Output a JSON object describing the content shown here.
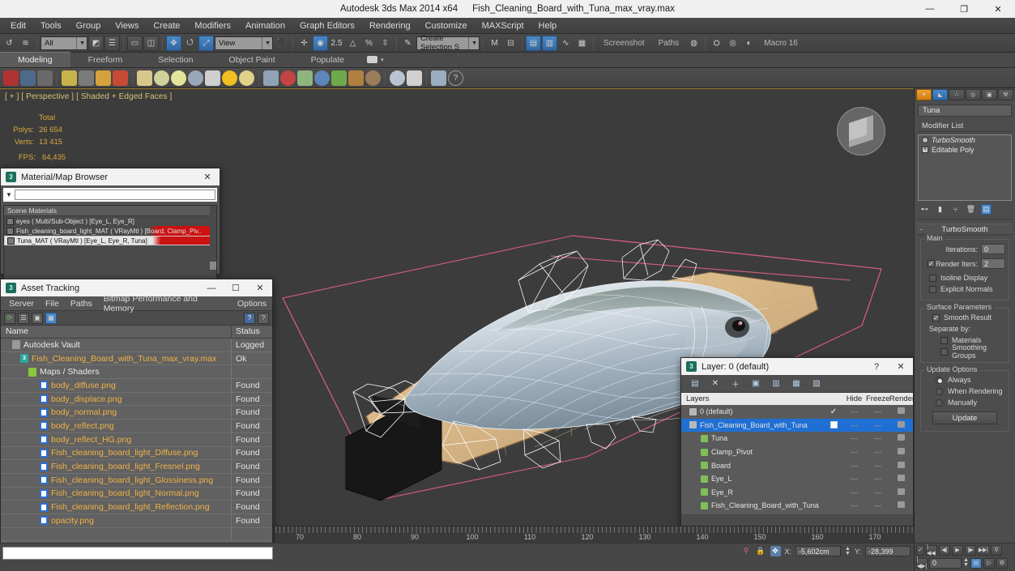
{
  "titlebar": {
    "app": "Autodesk 3ds Max  2014 x64",
    "file": "Fish_Cleaning_Board_with_Tuna_max_vray.max",
    "minimize": "—",
    "maximize": "❐",
    "close": "✕"
  },
  "menu": {
    "items": [
      "Edit",
      "Tools",
      "Group",
      "Views",
      "Create",
      "Modifiers",
      "Animation",
      "Graph Editors",
      "Rendering",
      "Customize",
      "MAXScript",
      "Help"
    ]
  },
  "main_toolbar": {
    "selection_filter": "All",
    "coord_system": "View",
    "named_selection_sets": "Create Selection S",
    "labels": {
      "screenshot": "Screenshot",
      "paths": "Paths",
      "macro": "Macro 16"
    },
    "icons": [
      "undo-icon",
      "redo-icon",
      "select-object-icon",
      "select-by-name-icon",
      "rectangular-select-icon",
      "window-crossing-icon",
      "select-and-move-icon",
      "select-and-rotate-icon",
      "select-and-scale-icon",
      "use-pivot-point-icon",
      "select-and-manipulate-icon",
      "snaps-toggle-icon",
      "angle-snap-icon",
      "percent-snap-icon",
      "spinner-snap-icon",
      "edit-named-selection-icon",
      "mirror-icon",
      "align-icon",
      "layer-manager-icon",
      "curve-editor-icon",
      "schematic-view-icon",
      "material-editor-icon",
      "render-setup-icon",
      "rendered-frame-icon",
      "render-production-icon"
    ]
  },
  "ribbon": {
    "tabs": [
      "Modeling",
      "Freeform",
      "Selection",
      "Object Paint",
      "Populate"
    ],
    "active_tab": "Modeling"
  },
  "viewport": {
    "label": "[ + ] [ Perspective ] [ Shaded + Edged Faces ]",
    "stats_header": "Total",
    "polys_label": "Polys:",
    "polys_value": "26 654",
    "verts_label": "Verts:",
    "verts_value": "13 415",
    "fps_label": "FPS:",
    "fps_value": "64,435"
  },
  "material_browser": {
    "title": "Material/Map Browser",
    "close": "✕",
    "search_placeholder": "",
    "group": "Scene Materials",
    "rows": [
      {
        "name": "eyes  ( Multi/Sub-Object )  [Eye_L, Eye_R]",
        "state": "normal"
      },
      {
        "name": "Fish_cleaning_board_light_MAT  ( VRayMtl )  [Board, Clamp_Piv..",
        "state": "red"
      },
      {
        "name": "Tuna_MAT  ( VRayMtl )  [Eye_L, Eye_R, Tuna]",
        "state": "selected"
      }
    ]
  },
  "asset_tracking": {
    "title": "Asset Tracking",
    "minimize": "—",
    "maximize": "☐",
    "close": "✕",
    "menu": [
      "Server",
      "File",
      "Paths",
      "Bitmap Performance and Memory",
      "Options"
    ],
    "columns": {
      "name": "Name",
      "status": "Status"
    },
    "rows": [
      {
        "name": "Autodesk Vault",
        "status": "Logged",
        "icon": "vault-icon",
        "indent": 1
      },
      {
        "name": "Fish_Cleaning_Board_with_Tuna_max_vray.max",
        "status": "Ok",
        "icon": "max-file-icon",
        "indent": 2,
        "highlight": true
      },
      {
        "name": "Maps / Shaders",
        "status": "",
        "icon": "folder-icon",
        "indent": 3
      },
      {
        "name": "body_diffuse.png",
        "status": "Found",
        "icon": "png-file-icon",
        "indent": 4,
        "highlight": true
      },
      {
        "name": "body_displace.png",
        "status": "Found",
        "icon": "png-file-icon",
        "indent": 4,
        "highlight": true
      },
      {
        "name": "body_normal.png",
        "status": "Found",
        "icon": "png-file-icon",
        "indent": 4,
        "highlight": true
      },
      {
        "name": "body_reflect.png",
        "status": "Found",
        "icon": "png-file-icon",
        "indent": 4,
        "highlight": true
      },
      {
        "name": "body_reflect_HG.png",
        "status": "Found",
        "icon": "png-file-icon",
        "indent": 4,
        "highlight": true
      },
      {
        "name": "Fish_cleaning_board_light_Diffuse.png",
        "status": "Found",
        "icon": "png-file-icon",
        "indent": 4,
        "highlight": true
      },
      {
        "name": "Fish_cleaning_board_light_Fresnel.png",
        "status": "Found",
        "icon": "png-file-icon",
        "indent": 4,
        "highlight": true
      },
      {
        "name": "Fish_cleaning_board_light_Glossiness.png",
        "status": "Found",
        "icon": "png-file-icon",
        "indent": 4,
        "highlight": true
      },
      {
        "name": "Fish_cleaning_board_light_Normal.png",
        "status": "Found",
        "icon": "png-file-icon",
        "indent": 4,
        "highlight": true
      },
      {
        "name": "Fish_cleaning_board_light_Reflection.png",
        "status": "Found",
        "icon": "png-file-icon",
        "indent": 4,
        "highlight": true
      },
      {
        "name": "opacity.png",
        "status": "Found",
        "icon": "png-file-icon",
        "indent": 4,
        "highlight": true
      }
    ]
  },
  "layer_dialog": {
    "title": "Layer: 0 (default)",
    "help": "?",
    "close": "✕",
    "columns": {
      "layers": "Layers",
      "hide": "Hide",
      "freeze": "Freeze",
      "render": "Render"
    },
    "rows": [
      {
        "name": "0 (default)",
        "hide": "",
        "freeze": "",
        "render": "camera-icon",
        "mark": "check",
        "selected": false,
        "child": false
      },
      {
        "name": "Fish_Cleaning_Board_with_Tuna",
        "hide": "",
        "freeze": "",
        "render": "camera-icon",
        "mark": "box",
        "selected": true,
        "child": false
      },
      {
        "name": "Tuna",
        "hide": "",
        "freeze": "",
        "render": "camera-icon",
        "mark": "",
        "selected": false,
        "child": true
      },
      {
        "name": "Clamp_Pivot",
        "hide": "",
        "freeze": "",
        "render": "camera-icon",
        "mark": "",
        "selected": false,
        "child": true
      },
      {
        "name": "Board",
        "hide": "",
        "freeze": "",
        "render": "camera-icon",
        "mark": "",
        "selected": false,
        "child": true
      },
      {
        "name": "Eye_L",
        "hide": "",
        "freeze": "",
        "render": "camera-icon",
        "mark": "",
        "selected": false,
        "child": true
      },
      {
        "name": "Eye_R",
        "hide": "",
        "freeze": "",
        "render": "camera-icon",
        "mark": "",
        "selected": false,
        "child": true
      },
      {
        "name": "Fish_Cleaning_Board_with_Tuna",
        "hide": "",
        "freeze": "",
        "render": "camera-icon",
        "mark": "",
        "selected": false,
        "child": true
      }
    ]
  },
  "command_panel": {
    "object_name": "Tuna",
    "modifier_list_label": "Modifier List",
    "modifiers": [
      {
        "name": "TurboSmooth",
        "active": true
      },
      {
        "name": "Editable Poly",
        "active": false
      }
    ],
    "rollup_title": "TurboSmooth",
    "groups": {
      "main": "Main",
      "surface_parameters": "Surface Parameters",
      "update_options": "Update Options"
    },
    "iterations_label": "Iterations:",
    "iterations_value": "0",
    "render_iters_label": "Render Iters:",
    "render_iters_value": "2",
    "render_iters_checked": true,
    "isoline_display": "Isoline Display",
    "isoline_checked": false,
    "explicit_normals": "Explicit Normals",
    "explicit_checked": false,
    "smooth_result": "Smooth Result",
    "smooth_checked": true,
    "separate_by": "Separate by:",
    "materials": "Materials",
    "materials_checked": false,
    "smoothing_groups": "Smoothing Groups",
    "smoothing_checked": false,
    "update_modes": [
      {
        "label": "Always",
        "selected": true
      },
      {
        "label": "When Rendering",
        "selected": false
      },
      {
        "label": "Manually",
        "selected": false
      }
    ],
    "update_button": "Update"
  },
  "timeline": {
    "tick_labels": [
      "70",
      "80",
      "90",
      "100",
      "110",
      "120",
      "130",
      "140",
      "150",
      "160",
      "170"
    ]
  },
  "status_bar": {
    "x_label": "X:",
    "x_value": "-5,602cm",
    "y_label": "Y:",
    "y_value": "-28,399",
    "icons": [
      "key-mode-icon",
      "lock-selection-icon",
      "absolute-mode-icon"
    ]
  },
  "anim_bar": {
    "frame_value": "0",
    "buttons": [
      "go-to-start-icon",
      "previous-frame-icon",
      "play-icon",
      "next-frame-icon",
      "go-to-end-icon",
      "key-mode-icon",
      "key-filters-icon",
      "set-key-icon",
      "auto-key-icon"
    ]
  },
  "colors": {
    "accent_blue": "#1f6fd4",
    "viewport_bg": "#3c3c3c",
    "stat_amber": "#d8a93c",
    "panel_gray": "#4d4d4d",
    "red_flag": "#cc1111"
  }
}
